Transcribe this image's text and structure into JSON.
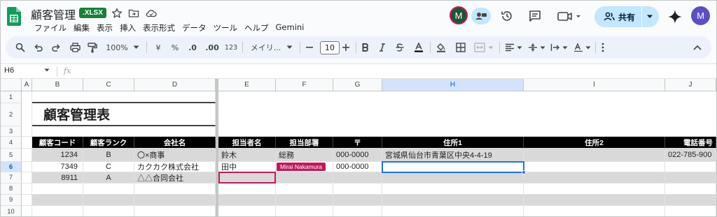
{
  "doc": {
    "title": "顧客管理",
    "format_badge": ".XLSX"
  },
  "menu": [
    "ファイル",
    "編集",
    "表示",
    "挿入",
    "表示形式",
    "データ",
    "ツール",
    "ヘルプ",
    "Gemini"
  ],
  "header": {
    "collaborator_initial": "M",
    "user_initial": "M",
    "share_label": "共有",
    "collaborator_ring_color": "#c2185b",
    "collaborator_bg": "#1e5631",
    "user_bg": "#5b4fc4"
  },
  "toolbar": {
    "zoom": "100%",
    "currency": "¥",
    "percent": "%",
    "decrease_decimals": ".0",
    "increase_decimals": ".00",
    "more_formats": "123",
    "font_name": "メイリ...",
    "font_size": "10"
  },
  "formula_bar": {
    "cell_ref": "H6",
    "fx": "fx",
    "value": ""
  },
  "columns": [
    "A",
    "B",
    "C",
    "D",
    "E",
    "F",
    "G",
    "H",
    "I",
    "J"
  ],
  "rows": [
    "1",
    "2",
    "3",
    "4",
    "5",
    "6",
    "7",
    "8",
    "9",
    "10"
  ],
  "sheet": {
    "title": "顧客管理表",
    "headers": [
      "顧客コード",
      "顧客ランク",
      "会社名",
      "担当者名",
      "担当部署",
      "〒",
      "住所1",
      "住所2",
      "電話番号"
    ],
    "records": [
      [
        "1234",
        "B",
        "〇×商事",
        "鈴木",
        "総務",
        "000-0000",
        "宮城県仙台市青葉区中央4-4-19",
        "",
        "022-785-900"
      ],
      [
        "7349",
        "C",
        "カクカク株式会社",
        "田中",
        "",
        "000-0000",
        "",
        "",
        ""
      ],
      [
        "8911",
        "A",
        "△△合同会社",
        "",
        "",
        "",
        "",
        "",
        ""
      ]
    ],
    "collaborator_chip": "Mirai Nakamura",
    "selected_column": "H",
    "selected_row": "6",
    "selection_color": "#1a73e8",
    "collaborator_color": "#c2185b"
  }
}
